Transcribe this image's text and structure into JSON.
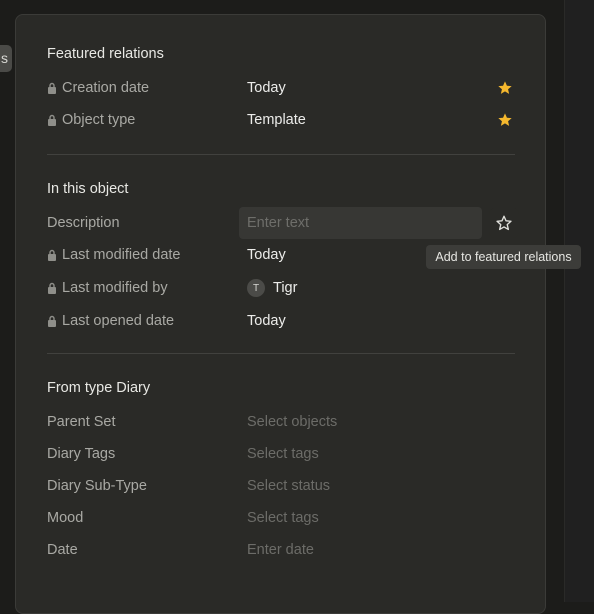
{
  "left_tab": {
    "text": "s"
  },
  "featured": {
    "title": "Featured relations",
    "rows": [
      {
        "label": "Creation date",
        "value": "Today"
      },
      {
        "label": "Object type",
        "value": "Template"
      }
    ]
  },
  "in_object": {
    "title": "In this object",
    "description": {
      "label": "Description",
      "placeholder": "Enter text"
    },
    "rows": [
      {
        "label": "Last modified date",
        "value": "Today"
      },
      {
        "label": "Last modified by",
        "value": "Tigr",
        "avatar_letter": "T"
      },
      {
        "label": "Last opened date",
        "value": "Today"
      }
    ],
    "tooltip": "Add to featured relations"
  },
  "from_type": {
    "title": "From type Diary",
    "rows": [
      {
        "label": "Parent Set",
        "placeholder": "Select objects"
      },
      {
        "label": "Diary Tags",
        "placeholder": "Select tags"
      },
      {
        "label": "Diary Sub-Type",
        "placeholder": "Select status"
      },
      {
        "label": "Mood",
        "placeholder": "Select tags"
      },
      {
        "label": "Date",
        "placeholder": "Enter date"
      }
    ]
  },
  "colors": {
    "star_filled": "#f5b82e",
    "panel_bg": "#2a2a27"
  },
  "icons": {
    "lock": "lock-icon",
    "star_filled": "star-filled-icon",
    "star_outline": "star-outline-icon"
  }
}
